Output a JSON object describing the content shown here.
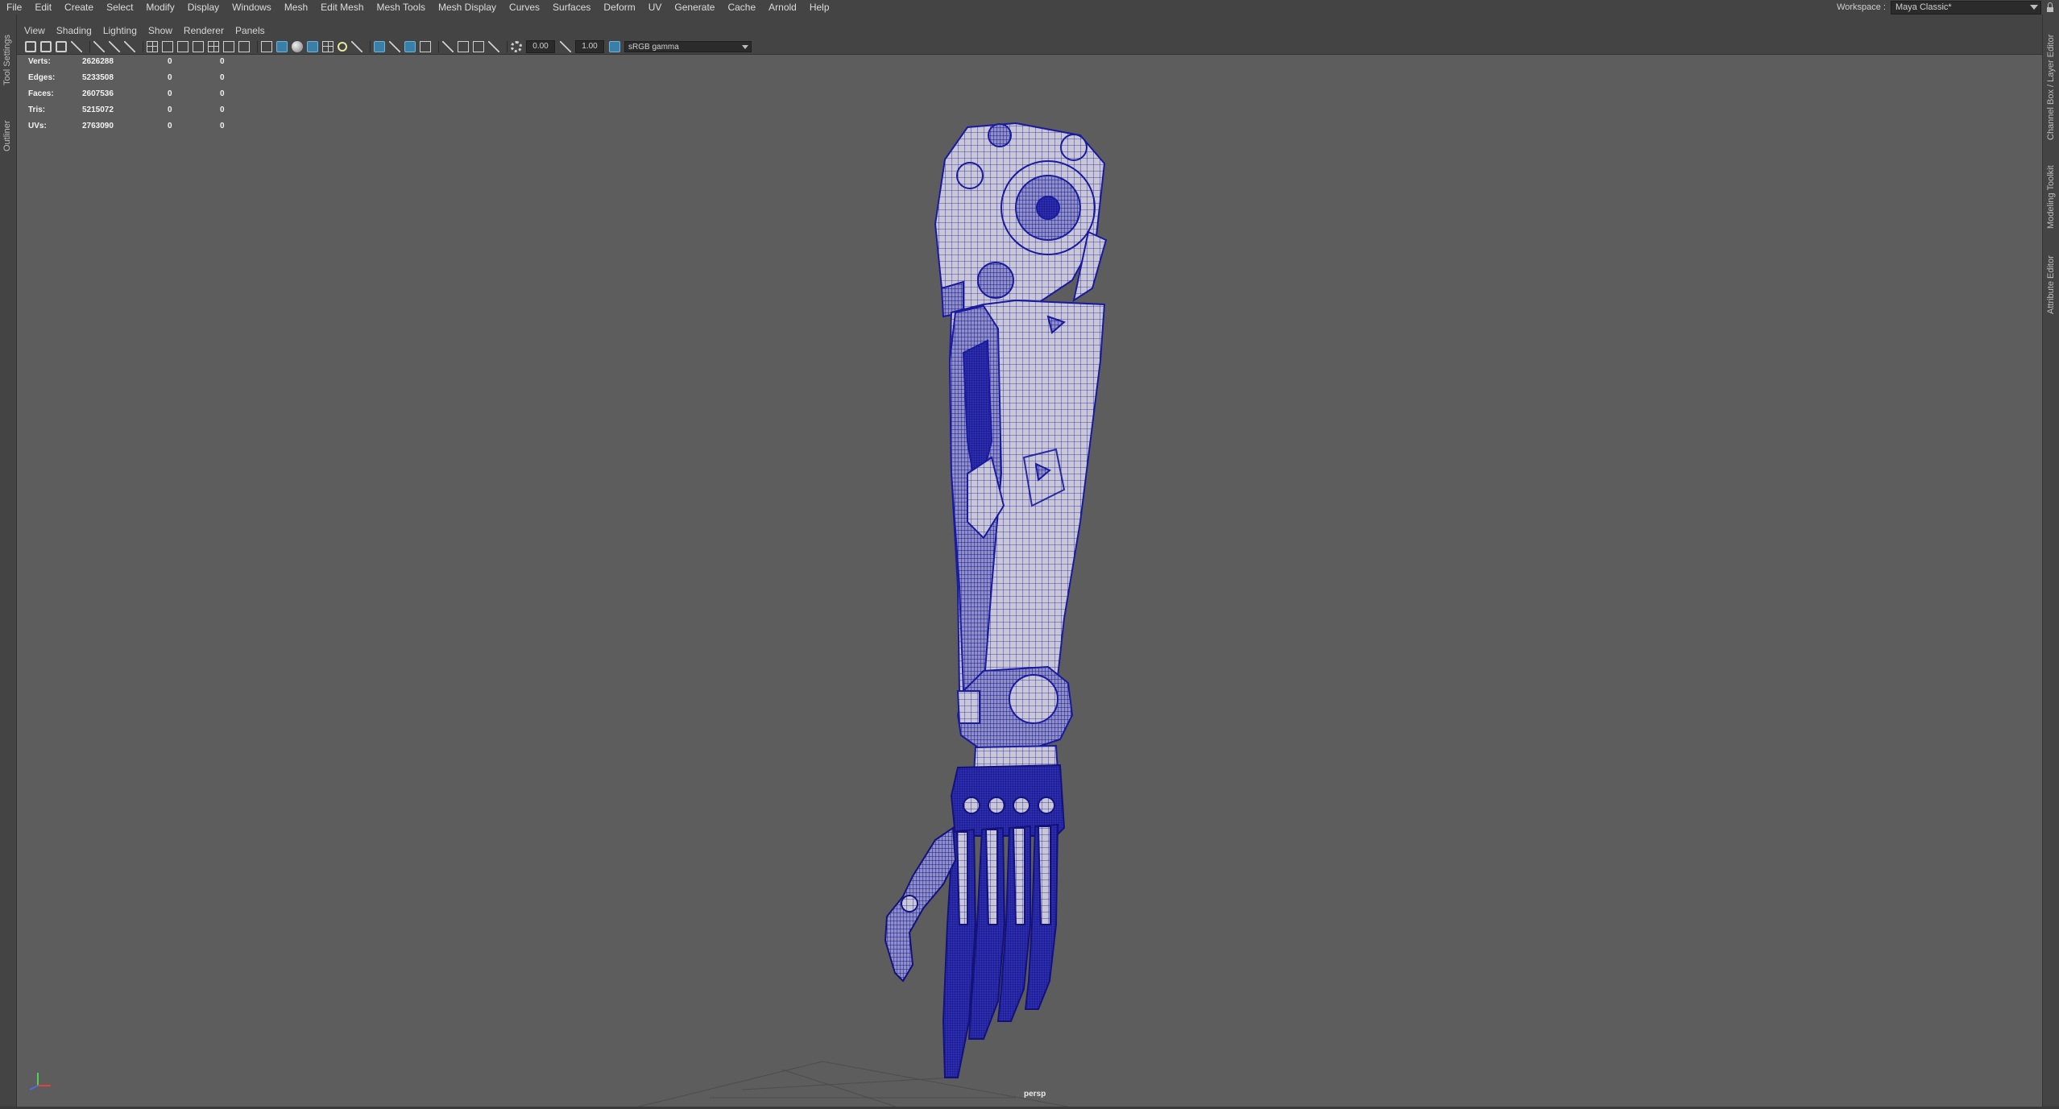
{
  "menu": [
    "File",
    "Edit",
    "Create",
    "Select",
    "Modify",
    "Display",
    "Windows",
    "Mesh",
    "Edit Mesh",
    "Mesh Tools",
    "Mesh Display",
    "Curves",
    "Surfaces",
    "Deform",
    "UV",
    "Generate",
    "Cache",
    "Arnold",
    "Help"
  ],
  "workspace": {
    "label": "Workspace :",
    "value": "Maya Classic*"
  },
  "left_tabs": {
    "tool_settings": "Tool Settings",
    "outliner": "Outliner"
  },
  "right_tabs": {
    "channel_box": "Channel Box / Layer Editor",
    "modeling_toolkit": "Modeling Toolkit",
    "attribute_editor": "Attribute Editor"
  },
  "panel_menu": [
    "View",
    "Shading",
    "Lighting",
    "Show",
    "Renderer",
    "Panels"
  ],
  "toolbar": {
    "exposure": "0.00",
    "gamma": "1.00",
    "color_space": "sRGB gamma"
  },
  "hud": [
    {
      "label": "Verts:",
      "v1": "2626288",
      "v2": "0",
      "v3": "0"
    },
    {
      "label": "Edges:",
      "v1": "5233508",
      "v2": "0",
      "v3": "0"
    },
    {
      "label": "Faces:",
      "v1": "2607536",
      "v2": "0",
      "v3": "0"
    },
    {
      "label": "Tris:",
      "v1": "5215072",
      "v2": "0",
      "v3": "0"
    },
    {
      "label": "UVs:",
      "v1": "2763090",
      "v2": "0",
      "v3": "0"
    }
  ],
  "camera": "persp",
  "colors": {
    "wireframe": "#1a1a9e",
    "mesh": "#c9c7d6",
    "viewport_bg": "#5d5d5d",
    "ui_bg": "#444444",
    "active_icon": "#3a7fa8"
  }
}
